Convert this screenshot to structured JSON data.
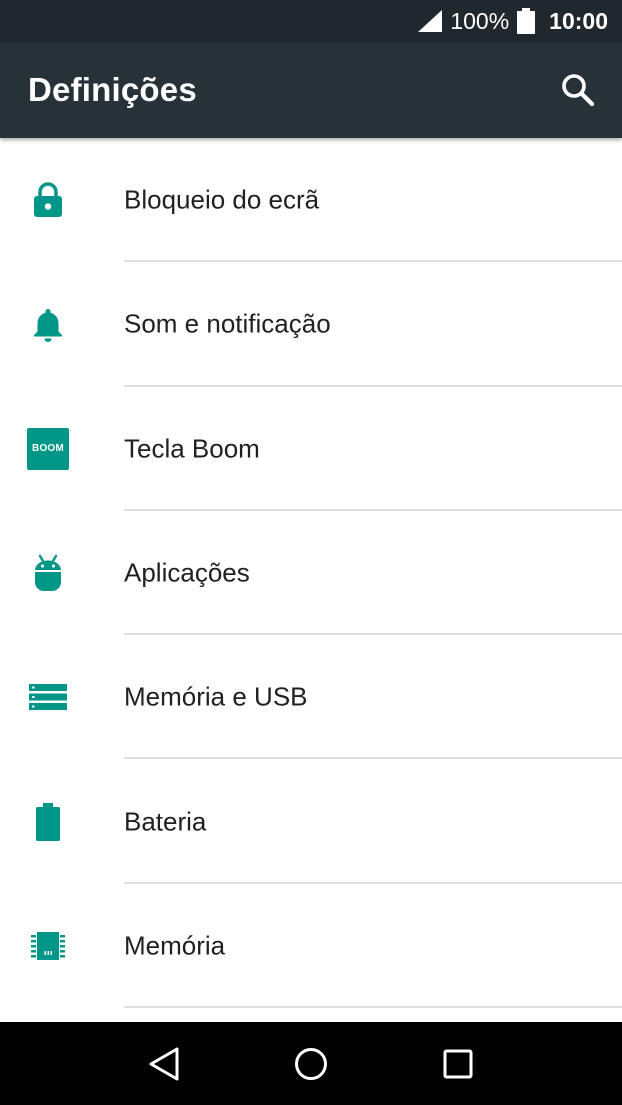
{
  "status": {
    "battery_percent": "100%",
    "time": "10:00"
  },
  "app_bar": {
    "title": "Definições"
  },
  "colors": {
    "accent": "#009688",
    "app_bar": "#263238",
    "status_bar": "#20272d"
  },
  "settings": [
    {
      "label": "Bloqueio do ecrã",
      "icon": "lock-icon"
    },
    {
      "label": "Som e notificação",
      "icon": "bell-icon"
    },
    {
      "label": "Tecla Boom",
      "icon": "boom-key-icon",
      "icon_text": "BOOM"
    },
    {
      "label": "Aplicações",
      "icon": "android-icon"
    },
    {
      "label": "Memória e USB",
      "icon": "storage-icon"
    },
    {
      "label": "Bateria",
      "icon": "battery-icon"
    },
    {
      "label": "Memória",
      "icon": "memory-chip-icon"
    }
  ],
  "nav": {
    "back": "back-icon",
    "home": "home-icon",
    "recents": "recents-icon"
  }
}
